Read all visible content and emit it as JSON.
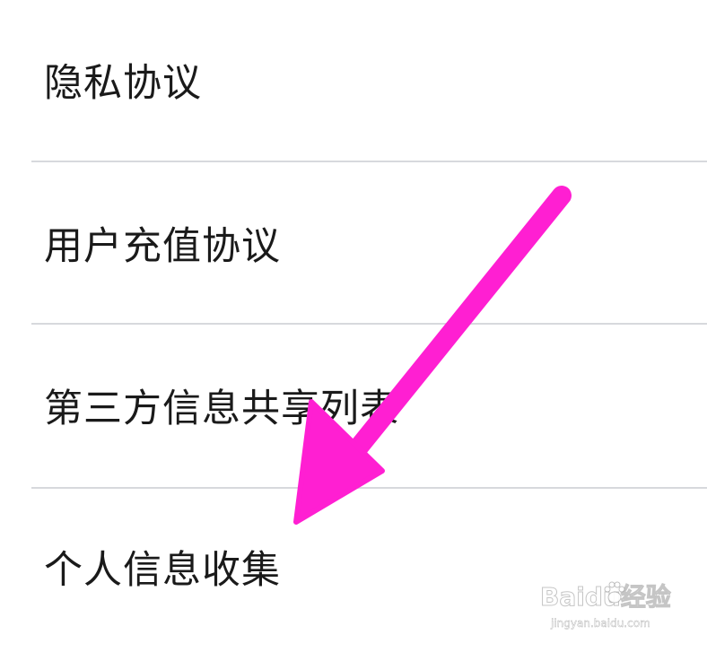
{
  "menu": {
    "items": [
      {
        "label": "隐私协议"
      },
      {
        "label": "用户充值协议"
      },
      {
        "label": "第三方信息共享列表"
      },
      {
        "label": "个人信息收集"
      }
    ]
  },
  "annotation": {
    "arrow_color": "#ff1fd2",
    "arrow_target": "menu.items.3"
  },
  "watermark": {
    "brand": "Baidu经验",
    "url": "jingyan.baidu.com"
  },
  "colors": {
    "background": "#ffffff",
    "text": "#1a1a1a",
    "divider": "#d7d9dd"
  }
}
